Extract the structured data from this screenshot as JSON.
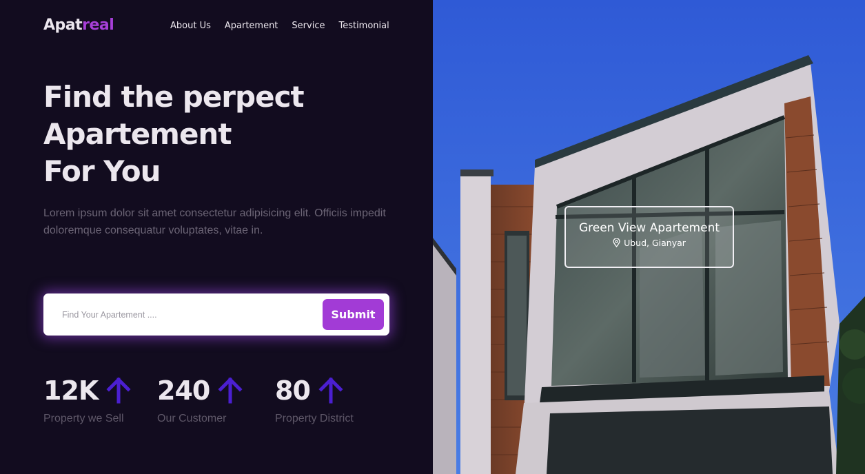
{
  "brand": {
    "name_main": "Apat",
    "name_accent": "real",
    "accent_color": "#a73fd8"
  },
  "nav": {
    "items": [
      "About Us",
      "Apartement",
      "Service",
      "Testimonial"
    ]
  },
  "hero": {
    "title_lines": [
      "Find the perpect",
      "Apartement",
      "For You"
    ],
    "description": "Lorem ipsum dolor sit amet consectetur adipisicing elit. Officiis impedit doloremque consequatur voluptates, vitae in."
  },
  "search": {
    "placeholder": "Find Your Apartement ....",
    "value": "",
    "submit_label": "Submit",
    "button_color": "#a23bd6"
  },
  "stats": [
    {
      "value": "12K",
      "label": "Property we Sell",
      "icon": "arrow-up-icon"
    },
    {
      "value": "240",
      "label": "Our Customer",
      "icon": "arrow-up-icon"
    },
    {
      "value": "80",
      "label": "Property District",
      "icon": "arrow-up-icon"
    }
  ],
  "feature": {
    "title": "Green View Apartement",
    "location": "Ubud, Gianyar",
    "location_icon": "map-pin-icon"
  },
  "colors": {
    "background": "#120c1f",
    "text": "#ece7ee",
    "muted": "#6b6475",
    "arrow": "#4b1fd1"
  }
}
